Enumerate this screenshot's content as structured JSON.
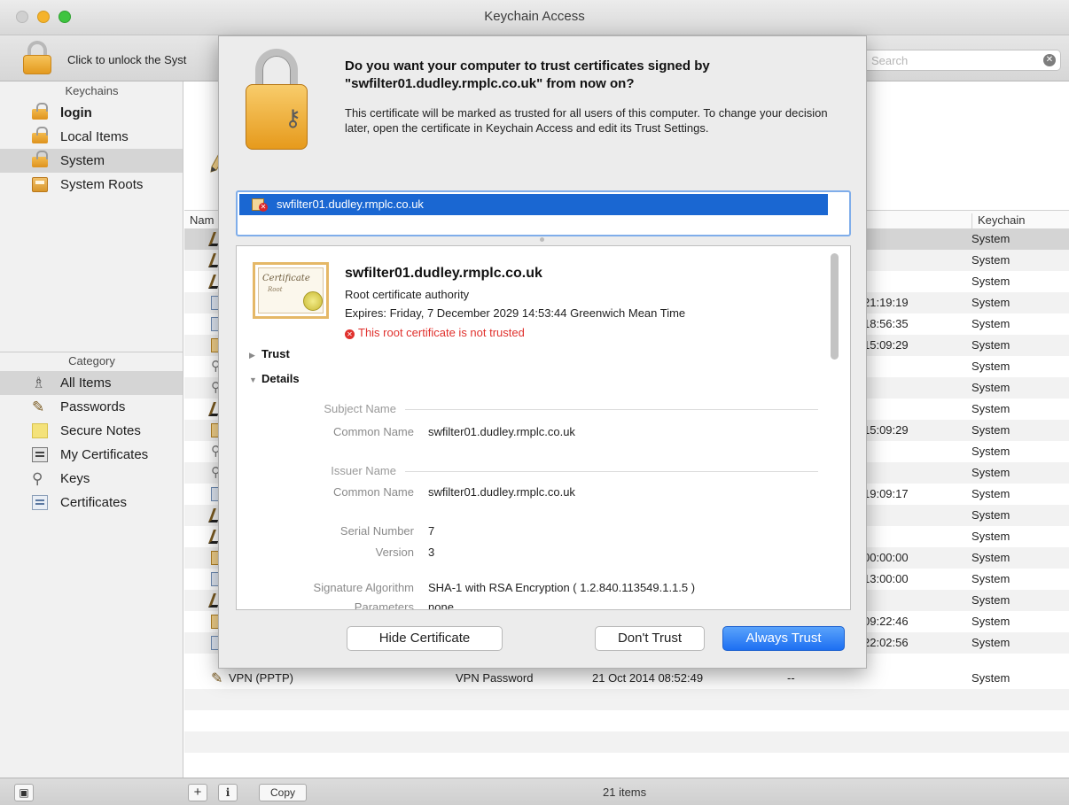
{
  "window": {
    "title": "Keychain Access"
  },
  "toolbar": {
    "unlock_text": "Click to unlock the Syst",
    "search_placeholder": "Search"
  },
  "sidebar": {
    "keychains_header": "Keychains",
    "keychains": [
      {
        "label": "login",
        "icon": "unlocked-padlock-icon"
      },
      {
        "label": "Local Items",
        "icon": "unlocked-padlock-icon"
      },
      {
        "label": "System",
        "icon": "padlock-icon",
        "selected": true
      },
      {
        "label": "System Roots",
        "icon": "cabinet-icon"
      }
    ],
    "category_header": "Category",
    "categories": [
      {
        "label": "All Items",
        "icon": "people-icon",
        "selected": true
      },
      {
        "label": "Passwords",
        "icon": "pen-icon"
      },
      {
        "label": "Secure Notes",
        "icon": "note-icon"
      },
      {
        "label": "My Certificates",
        "icon": "my-certificate-icon"
      },
      {
        "label": "Keys",
        "icon": "key-icon"
      },
      {
        "label": "Certificates",
        "icon": "certificate-icon"
      }
    ]
  },
  "list": {
    "header_name": "Nam",
    "header_keychain": "Keychain",
    "rows": [
      {
        "date": "",
        "keychain": "System"
      },
      {
        "date": "",
        "keychain": "System"
      },
      {
        "date": "",
        "keychain": "System"
      },
      {
        "date": "21:19:19",
        "keychain": "System"
      },
      {
        "date": "18:56:35",
        "keychain": "System"
      },
      {
        "date": "15:09:29",
        "keychain": "System"
      },
      {
        "date": "",
        "keychain": "System"
      },
      {
        "date": "",
        "keychain": "System"
      },
      {
        "date": "",
        "keychain": "System"
      },
      {
        "date": "15:09:29",
        "keychain": "System"
      },
      {
        "date": "",
        "keychain": "System"
      },
      {
        "date": "",
        "keychain": "System"
      },
      {
        "date": "19:09:17",
        "keychain": "System"
      },
      {
        "date": "",
        "keychain": "System"
      },
      {
        "date": "",
        "keychain": "System"
      },
      {
        "date": "00:00:00",
        "keychain": "System"
      },
      {
        "date": "13:00:00",
        "keychain": "System"
      },
      {
        "date": "",
        "keychain": "System"
      },
      {
        "date": "09:22:46",
        "keychain": "System"
      },
      {
        "date": "22:02:56",
        "keychain": "System"
      }
    ],
    "last_row": {
      "name": "VPN (PPTP)",
      "kind": "VPN Password",
      "date": "21 Oct 2014 08:52:49",
      "expires": "--",
      "keychain": "System"
    }
  },
  "bottombar": {
    "add_label": "+",
    "info_label": "i",
    "copy_label": "Copy",
    "item_count": "21 items"
  },
  "dialog": {
    "question": "Do you want your computer to trust certificates signed by \"swfilter01.dudley.rmplc.co.uk\" from now on?",
    "explanation": "This certificate will be marked as trusted for all users of this computer. To change your decision later, open the certificate in Keychain Access and edit its Trust Settings.",
    "chain_item": "swfilter01.dudley.rmplc.co.uk",
    "cert": {
      "thumbnail_text": "Certificate",
      "thumbnail_sub": "Root",
      "name": "swfilter01.dudley.rmplc.co.uk",
      "type": "Root certificate authority",
      "expires": "Expires: Friday, 7 December 2029 14:53:44 Greenwich Mean Time",
      "warning": "This root certificate is not trusted"
    },
    "trust_label": "Trust",
    "details_label": "Details",
    "subject_header": "Subject Name",
    "subject_cn_key": "Common Name",
    "subject_cn_val": "swfilter01.dudley.rmplc.co.uk",
    "issuer_header": "Issuer Name",
    "issuer_cn_key": "Common Name",
    "issuer_cn_val": "swfilter01.dudley.rmplc.co.uk",
    "serial_key": "Serial Number",
    "serial_val": "7",
    "version_key": "Version",
    "version_val": "3",
    "sigalg_key": "Signature Algorithm",
    "sigalg_val": "SHA-1 with RSA Encryption ( 1.2.840.113549.1.1.5 )",
    "params_key": "Parameters",
    "params_val": "none",
    "hide_cert_label": "Hide Certificate",
    "dont_trust_label": "Don't Trust",
    "always_trust_label": "Always Trust"
  },
  "colors": {
    "accent": "#1a67d2",
    "warning": "#e0312d"
  }
}
